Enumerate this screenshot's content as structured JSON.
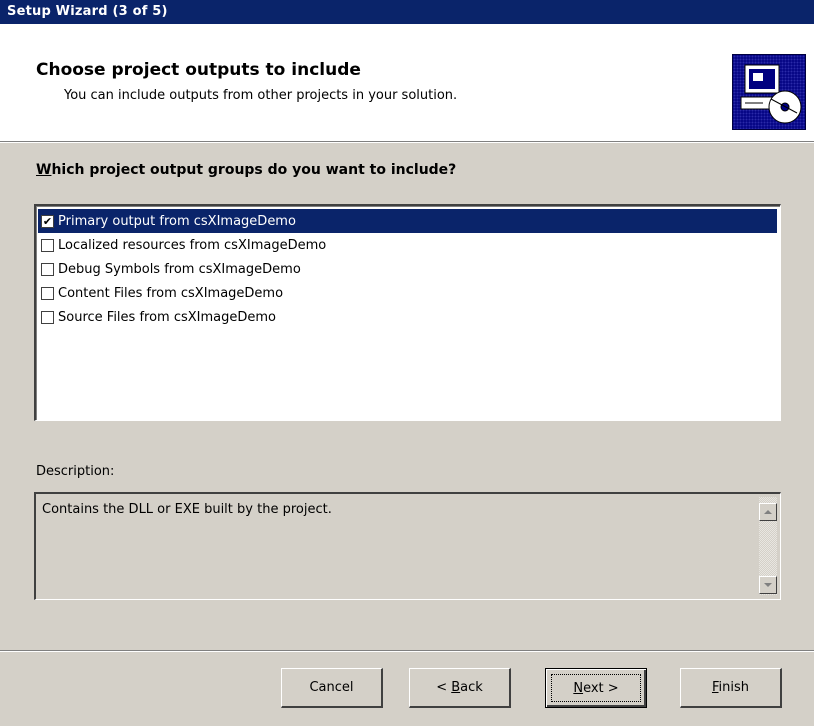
{
  "window": {
    "title": "Setup Wizard (3 of 5)"
  },
  "header": {
    "title": "Choose project outputs to include",
    "subtitle": "You can include outputs from other projects in your solution.",
    "icon": "computer-cd-icon"
  },
  "question": {
    "accel": "W",
    "rest": "hich project output groups do you want to include?"
  },
  "output_groups": [
    {
      "label": "Primary output from csXImageDemo",
      "checked": true,
      "selected": true
    },
    {
      "label": "Localized resources from csXImageDemo",
      "checked": false,
      "selected": false
    },
    {
      "label": "Debug Symbols from csXImageDemo",
      "checked": false,
      "selected": false
    },
    {
      "label": "Content Files from csXImageDemo",
      "checked": false,
      "selected": false
    },
    {
      "label": "Source Files from csXImageDemo",
      "checked": false,
      "selected": false
    }
  ],
  "description": {
    "label": "Description:",
    "text": "Contains the DLL or EXE built by the project."
  },
  "buttons": {
    "cancel": "Cancel",
    "back": {
      "prefix": "< ",
      "accel": "B",
      "rest": "ack"
    },
    "next": {
      "prefix": "",
      "accel": "N",
      "rest": "ext >"
    },
    "finish": {
      "prefix": "",
      "accel": "F",
      "rest": "inish"
    }
  },
  "colors": {
    "titlebar": "#0a246a",
    "selection": "#0a246a",
    "face": "#d4d0c8"
  }
}
